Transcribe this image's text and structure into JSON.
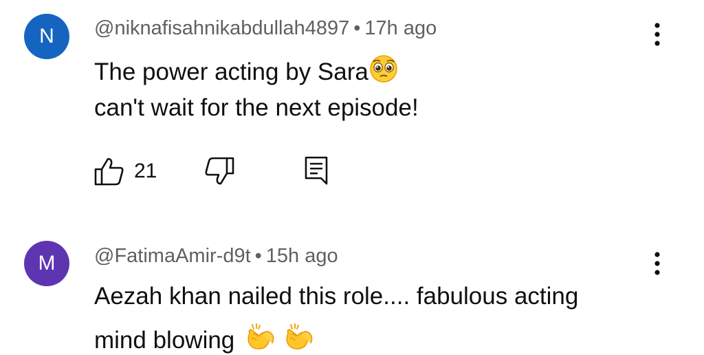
{
  "comments": [
    {
      "avatar_letter": "N",
      "avatar_color": "#1565c0",
      "handle": "@niknafisahnikabdullah4897",
      "separator": "•",
      "time": "17h ago",
      "lines": [
        "The power acting by Sara",
        "can't wait for the next episode!"
      ],
      "emojis": [
        "pleading-face"
      ],
      "likes": "21"
    },
    {
      "avatar_letter": "M",
      "avatar_color": "#5e35b1",
      "handle": "@FatimaAmir-d9t",
      "separator": "•",
      "time": "15h ago",
      "lines": [
        "Aezah khan nailed this role.... fabulous acting",
        "mind blowing"
      ],
      "emojis": [
        "clapping-hands",
        "clapping-hands"
      ]
    }
  ],
  "colors": {
    "text": "#0f0f0f",
    "meta": "#606060",
    "background": "#ffffff"
  }
}
